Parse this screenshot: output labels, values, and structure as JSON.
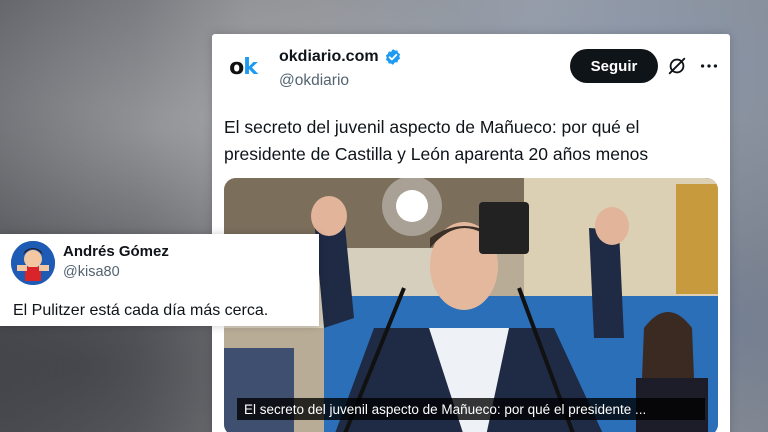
{
  "tweet": {
    "account_name": "okdiario.com",
    "handle": "@okdiario",
    "logo_text": {
      "o": "o",
      "k": "k"
    },
    "follow_label": "Seguir",
    "text": "El secreto del juvenil aspecto de Mañueco: por qué el presidente de Castilla y León aparenta 20 años menos",
    "media_caption": "El secreto del juvenil aspecto de Mañueco: por qué el presidente ...",
    "verified": true
  },
  "reply": {
    "name": "Andrés Gómez",
    "handle": "@kisa80",
    "text": "El Pulitzer está cada día más cerca."
  },
  "colors": {
    "verified": "#1d9bf0",
    "button_bg": "#0f1419",
    "handle": "#536471"
  },
  "icons": {
    "verified": "verified-badge-icon",
    "grok": "grok-icon",
    "more": "more-icon"
  }
}
